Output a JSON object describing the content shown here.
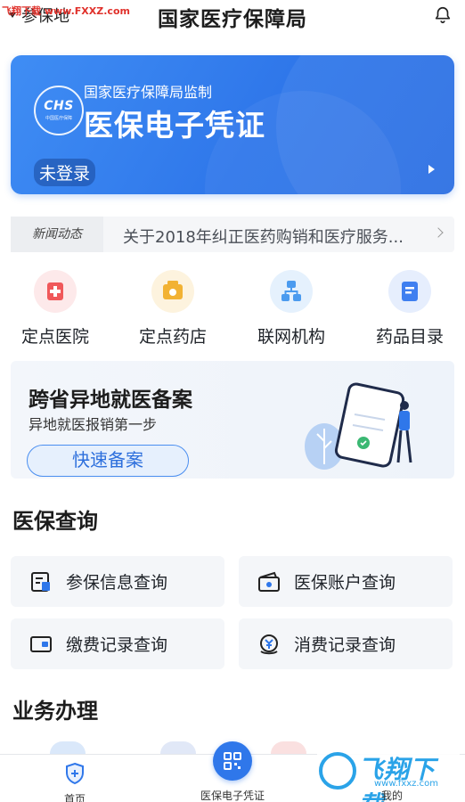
{
  "watermark": {
    "top_text": "飞翔下载 www.FXXZ.com",
    "logo_text": "飞翔下载",
    "logo_url": "www.fxxz.com"
  },
  "header": {
    "region": "参保地",
    "title": "国家医疗保障局"
  },
  "card": {
    "logo_text": "CHS",
    "logo_sub": "中国医疗保障",
    "supervise": "国家医疗保障局监制",
    "title": "医保电子凭证",
    "login_status": "未登录"
  },
  "news": {
    "tag": "新闻动态",
    "headline": "关于2018年纠正医药购销和医疗服务..."
  },
  "quick_links": [
    {
      "label": "定点医院",
      "icon": "hospital-icon",
      "color": "#f0585a",
      "bg": "#fde9ea"
    },
    {
      "label": "定点药店",
      "icon": "pharmacy-icon",
      "color": "#f2b233",
      "bg": "#fdf3de"
    },
    {
      "label": "联网机构",
      "icon": "network-icon",
      "color": "#4b9bef",
      "bg": "#e5f1fd"
    },
    {
      "label": "药品目录",
      "icon": "catalog-icon",
      "color": "#3f7ff0",
      "bg": "#e6eefd"
    }
  ],
  "banner": {
    "title": "跨省异地就医备案",
    "subtitle": "异地就医报销第一步",
    "button": "快速备案"
  },
  "sections": {
    "query": "医保查询",
    "business": "业务办理"
  },
  "query_tiles": [
    {
      "label": "参保信息查询",
      "icon": "insurance-info-icon"
    },
    {
      "label": "医保账户查询",
      "icon": "account-icon"
    },
    {
      "label": "缴费记录查询",
      "icon": "payment-record-icon"
    },
    {
      "label": "消费记录查询",
      "icon": "consumption-record-icon"
    }
  ],
  "tabbar": {
    "home": "首页",
    "voucher": "医保电子凭证",
    "mine": "我的"
  },
  "colors": {
    "primary": "#2f77ea",
    "text": "#1f2329"
  }
}
